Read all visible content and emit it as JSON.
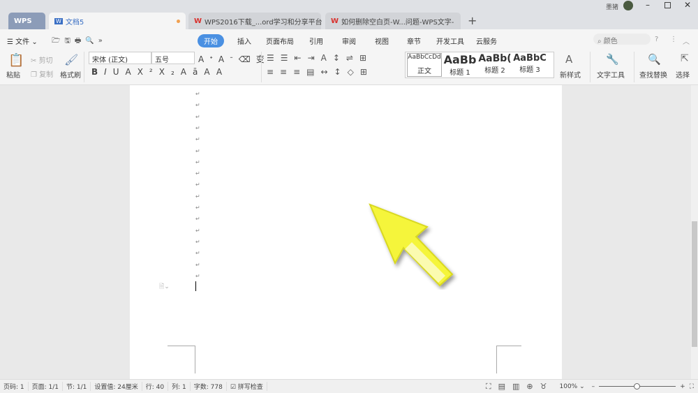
{
  "tabs": [
    {
      "label": "WPS"
    },
    {
      "label": "文档5"
    },
    {
      "label": "WPS2016下载_...ord学习和分享平台"
    },
    {
      "label": "如何删除空白页-W...问题-WPS文字-"
    }
  ],
  "user": {
    "name": "墨猪"
  },
  "menu": {
    "file": "文件",
    "tabs": [
      "开始",
      "插入",
      "页面布局",
      "引用",
      "审阅",
      "视图",
      "章节",
      "开发工具",
      "云服务"
    ],
    "search_placeholder": "颜色"
  },
  "ribbon": {
    "paste": "粘贴",
    "cut": "剪切",
    "copy": "复制",
    "format_painter": "格式刷",
    "font": "宋体 (正文)",
    "size": "五号",
    "styles": [
      {
        "preview": "AaBbCcDd",
        "name": "正文"
      },
      {
        "preview": "AaBb",
        "name": "标题 1"
      },
      {
        "preview": "AaBb(",
        "name": "标题 2"
      },
      {
        "preview": "AaBbC",
        "name": "标题 3"
      }
    ],
    "new_style": "新样式",
    "text_tools": "文字工具",
    "find_replace": "查找替换",
    "select": "选择"
  },
  "document": {
    "paragraph_mark": "↵"
  },
  "status": {
    "page_num": "页码: 1",
    "pages": "页面: 1/1",
    "section": "节: 1/1",
    "setting": "设置值: 24厘米",
    "row": "行: 40",
    "col": "列: 1",
    "words": "字数: 778",
    "spell": "拼写检查",
    "zoom": "100%"
  },
  "colors": {
    "accent": "#4a90e2",
    "arrow": "#f5f53a"
  }
}
